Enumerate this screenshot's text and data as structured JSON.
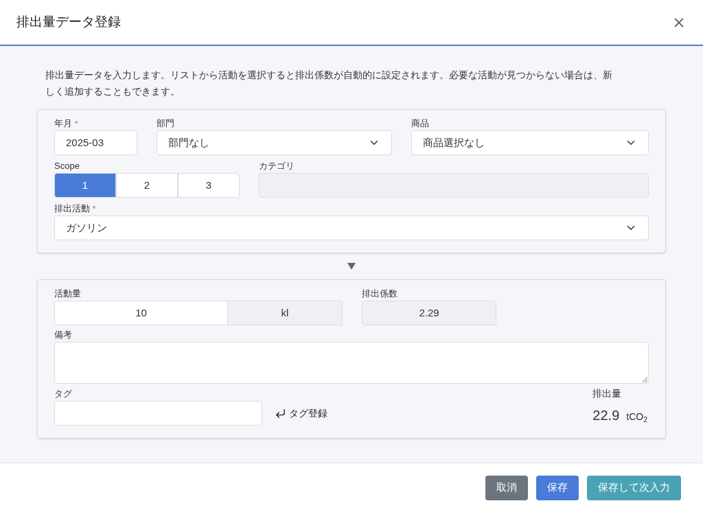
{
  "dialog": {
    "title": "排出量データ登録"
  },
  "description": "排出量データを入力します。リストから活動を選択すると排出係数が自動的に設定されます。必要な活動が見つからない場合は、新しく追加することもできます。",
  "year_month": {
    "label": "年月",
    "required_mark": "*",
    "value": "2025-03"
  },
  "department": {
    "label": "部門",
    "value": "部門なし"
  },
  "product": {
    "label": "商品",
    "value": "商品選択なし"
  },
  "scope": {
    "label": "Scope",
    "options": [
      {
        "label": "1",
        "selected": true
      },
      {
        "label": "2",
        "selected": false
      },
      {
        "label": "3",
        "selected": false
      }
    ]
  },
  "category": {
    "label": "カテゴリ"
  },
  "activity": {
    "label": "排出活動",
    "required_mark": "*",
    "value": "ガソリン"
  },
  "amount": {
    "label": "活動量",
    "value": "10",
    "unit": "kl"
  },
  "factor": {
    "label": "排出係数",
    "value": "2.29"
  },
  "notes": {
    "label": "備考"
  },
  "tag": {
    "label": "タグ",
    "register": "タグ登録"
  },
  "emissions": {
    "label": "排出量",
    "value": "22.9",
    "unit": "tCO$_{2}$"
  },
  "buttons": [
    {
      "label": "取消",
      "kind": "cancel"
    },
    {
      "label": "保存",
      "kind": "primary"
    },
    {
      "label": "保存して次入力",
      "kind": "next"
    }
  ]
}
